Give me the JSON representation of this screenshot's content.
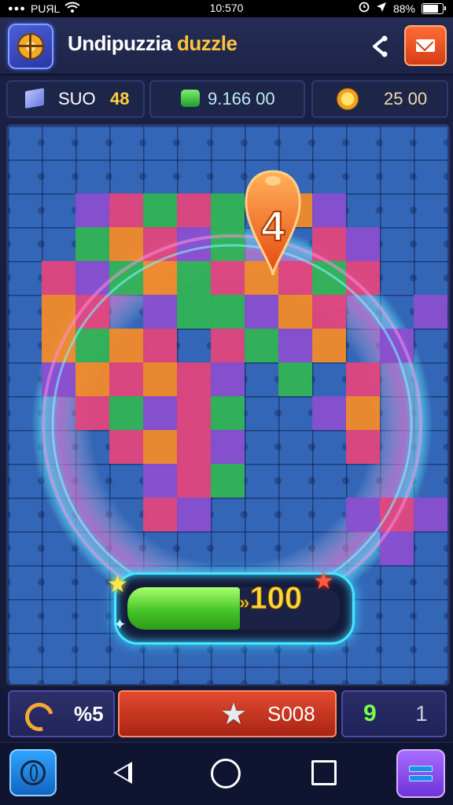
{
  "status_bar": {
    "carrier": "PUЯL",
    "time": "10:570",
    "battery": "88%",
    "battery_level": 0.88
  },
  "header": {
    "title_part1": "Undipuzzia",
    "title_part2": "duzzle"
  },
  "resources": [
    {
      "label": "SUO",
      "value": "48",
      "icon": "cube-icon"
    },
    {
      "value": "9.166 00",
      "icon": "green-gem-icon"
    },
    {
      "value": "25 00",
      "icon": "gold-coin-icon"
    }
  ],
  "board": {
    "level_marker": "4"
  },
  "progress": {
    "label": "100",
    "fill": 0.53,
    "prefix_glyph": "»"
  },
  "bottom_bar": {
    "left_value": "%5",
    "center_value": "S008",
    "right_value_1": "9",
    "right_value_2": "1"
  },
  "colors": {
    "accent": "#ffc43b",
    "board": "#3466b7",
    "progress": "#46c529",
    "neon": "#46e8ff"
  }
}
